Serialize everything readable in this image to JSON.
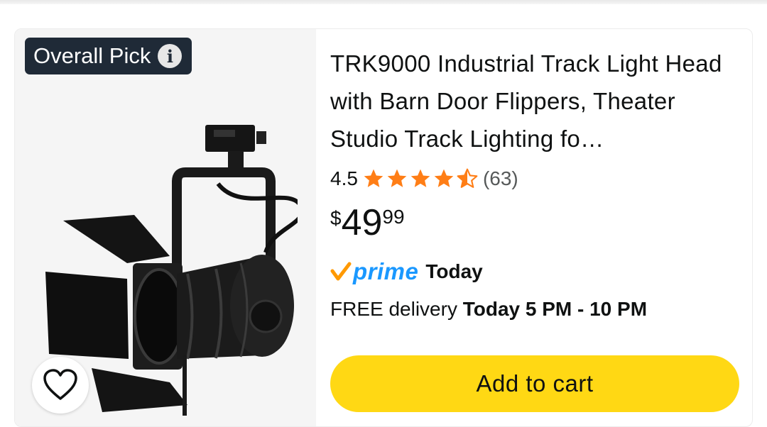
{
  "badge": {
    "label": "Overall Pick",
    "icon": "info-icon"
  },
  "product": {
    "title": "TRK9000 Industrial Track Light Head with Barn Door Flippers, Theater Studio Track Lighting fo…",
    "rating": "4.5",
    "stars": 4.5,
    "rating_count": "(63)",
    "price": {
      "symbol": "$",
      "whole": "49",
      "fraction": "99"
    },
    "prime": {
      "logo_text": "prime",
      "label": "Today"
    },
    "delivery": {
      "prefix": "FREE delivery ",
      "time": "Today 5 PM - 10 PM"
    }
  },
  "actions": {
    "add_to_cart": "Add to cart",
    "wishlist_icon": "heart-icon"
  },
  "colors": {
    "badge_bg": "#1f2a37",
    "star": "#ff7e16",
    "prime_blue": "#1a98ff",
    "prime_check": "#ff9900",
    "cart_button": "#ffd814"
  }
}
